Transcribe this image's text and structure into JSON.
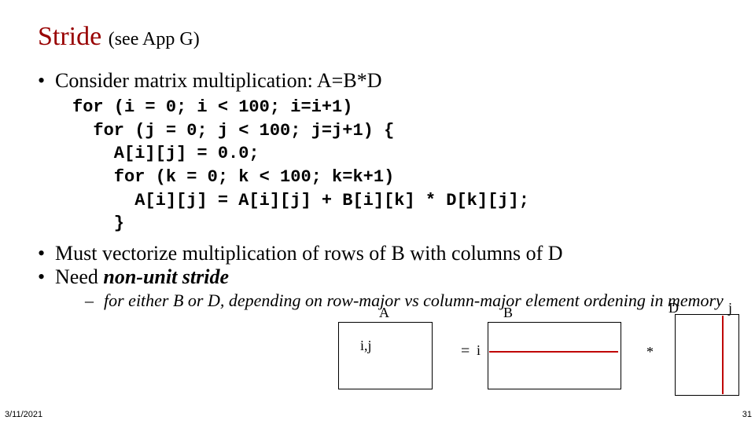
{
  "title": {
    "main": "Stride",
    "sub": "(see App G)"
  },
  "bullets": {
    "b1": "Consider  matrix multiplication: A=B*D",
    "b2": "Must vectorize multiplication of rows of B with columns of D",
    "b3_prefix": "Need ",
    "b3_em": "non-unit stride",
    "sub": "for either B or D, depending on row-major vs column-major element ordening in memory"
  },
  "code": "for (i = 0; i < 100; i=i+1)\n  for (j = 0; j < 100; j=j+1) {\n    A[i][j] = 0.0;\n    for (k = 0; k < 100; k=k+1)\n      A[i][j] = A[i][j] + B[i][k] * D[k][j];\n    }",
  "diagram": {
    "A": "A",
    "B": "B",
    "D": "D",
    "ij": "i,j",
    "eq": "=",
    "i": "i",
    "star": "*",
    "j": "j"
  },
  "footer": {
    "date": "3/11/2021",
    "page": "31"
  },
  "colors": {
    "title": "#980000",
    "accent": "#c00000"
  }
}
